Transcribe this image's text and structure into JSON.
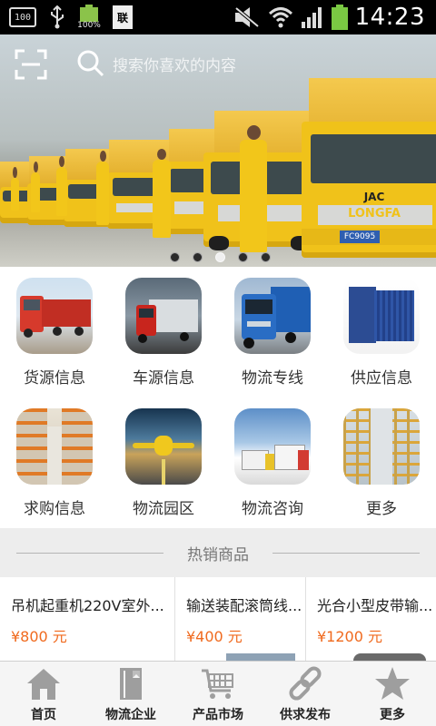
{
  "status_bar": {
    "left_badge": "100",
    "battery_small_pct": "100%",
    "doc_badge": "联",
    "time": "14:23"
  },
  "banner": {
    "search_placeholder": "搜索你喜欢的内容",
    "slide_count": 5,
    "active_slide": 3,
    "truck_brand": "JAC",
    "truck_model": "LONGFA",
    "plate": "FC9095"
  },
  "categories": [
    {
      "label": "货源信息",
      "icon": "red-truck-image"
    },
    {
      "label": "车源信息",
      "icon": "cargo-truck-image"
    },
    {
      "label": "物流专线",
      "icon": "blue-truck-image"
    },
    {
      "label": "供应信息",
      "icon": "container-image"
    },
    {
      "label": "求购信息",
      "icon": "warehouse-image"
    },
    {
      "label": "物流园区",
      "icon": "airplane-image"
    },
    {
      "label": "物流咨询",
      "icon": "trucks-sky-image"
    },
    {
      "label": "更多",
      "icon": "storage-racks-image"
    }
  ],
  "hot": {
    "title": "热销商品",
    "products": [
      {
        "name": "吊机起重机220V室外...",
        "price": "¥800 元"
      },
      {
        "name": "输送装配滚筒线...",
        "price": "¥400 元"
      },
      {
        "name": "光合小型皮带输...",
        "price": "¥1200 元"
      }
    ]
  },
  "tabs": [
    {
      "label": "首页",
      "icon": "home-icon"
    },
    {
      "label": "物流企业",
      "icon": "building-icon"
    },
    {
      "label": "产品市场",
      "icon": "cart-icon"
    },
    {
      "label": "供求发布",
      "icon": "link-icon"
    },
    {
      "label": "更多",
      "icon": "star-icon"
    }
  ],
  "colors": {
    "price": "#f06a1e",
    "truck_yellow": "#f0c21a",
    "battery_green": "#7ac943"
  }
}
